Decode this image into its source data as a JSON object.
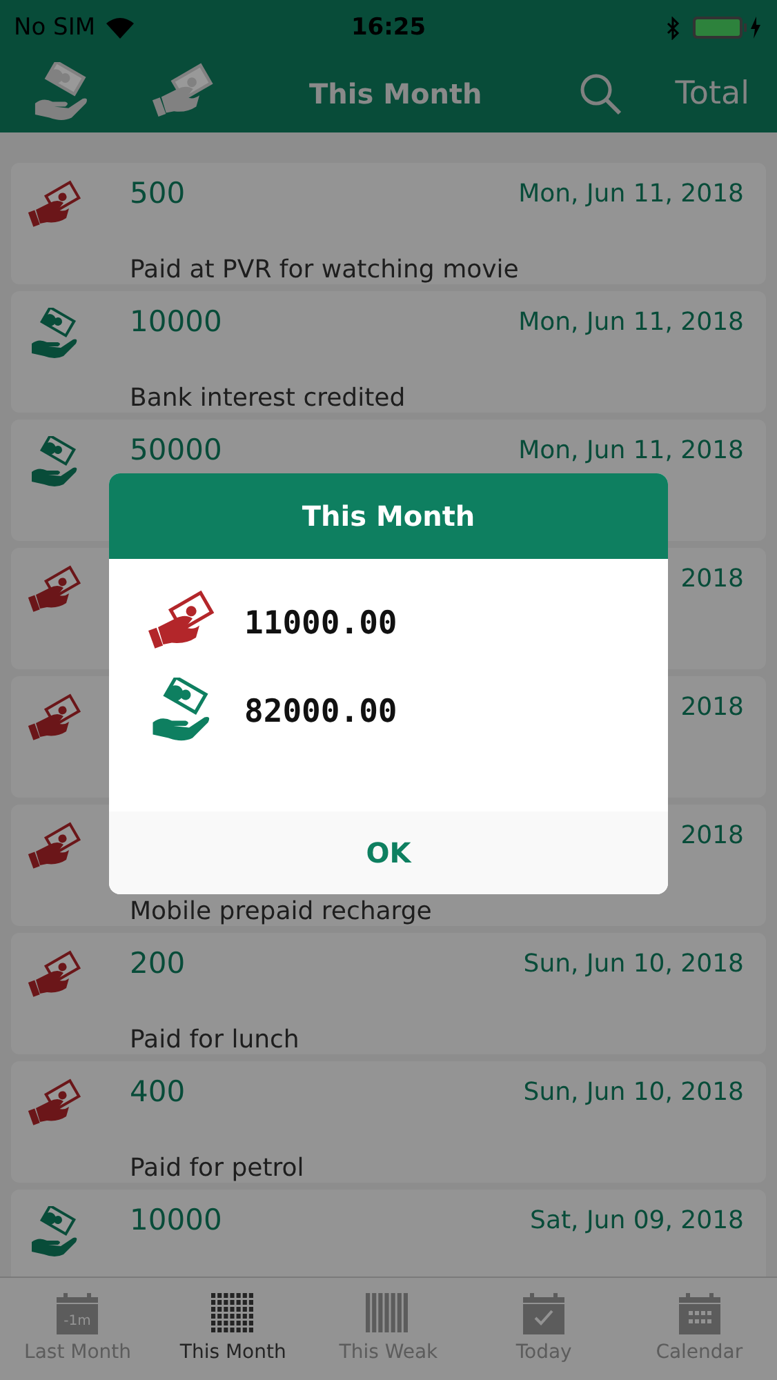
{
  "status_bar": {
    "carrier": "No SIM",
    "time": "16:25"
  },
  "nav_bar": {
    "title": "This Month",
    "total_button": "Total"
  },
  "transactions": [
    {
      "kind": "expense",
      "amount": "500",
      "date": "Mon, Jun 11, 2018",
      "description": "Paid at PVR for watching movie"
    },
    {
      "kind": "income",
      "amount": "10000",
      "date": "Mon, Jun 11, 2018",
      "description": "Bank interest credited"
    },
    {
      "kind": "income",
      "amount": "50000",
      "date": "Mon, Jun 11, 2018"
    },
    {
      "kind": "expense",
      "date": "2018"
    },
    {
      "kind": "expense",
      "date": "2018"
    },
    {
      "kind": "expense",
      "date": "2018",
      "description": "Mobile prepaid recharge"
    },
    {
      "kind": "expense",
      "amount": "200",
      "date": "Sun, Jun 10, 2018",
      "description": "Paid for lunch"
    },
    {
      "kind": "expense",
      "amount": "400",
      "date": "Sun, Jun 10, 2018",
      "description": "Paid for petrol"
    },
    {
      "kind": "income",
      "amount": "10000",
      "date": "Sat, Jun 09, 2018"
    }
  ],
  "dialog": {
    "title": "This Month",
    "totals": [
      {
        "kind": "expense",
        "amount": "11000.00"
      },
      {
        "kind": "income",
        "amount": "82000.00"
      }
    ],
    "button": "OK"
  },
  "tabs": [
    {
      "kind": "last-month",
      "label": "Last Month",
      "icon_text": "-1m",
      "selected": false
    },
    {
      "kind": "month",
      "label": "This Month",
      "selected": true
    },
    {
      "kind": "week",
      "label": "This Weak",
      "selected": false
    },
    {
      "kind": "today",
      "label": "Today",
      "selected": false
    },
    {
      "kind": "calendar",
      "label": "Calendar",
      "selected": false
    }
  ]
}
